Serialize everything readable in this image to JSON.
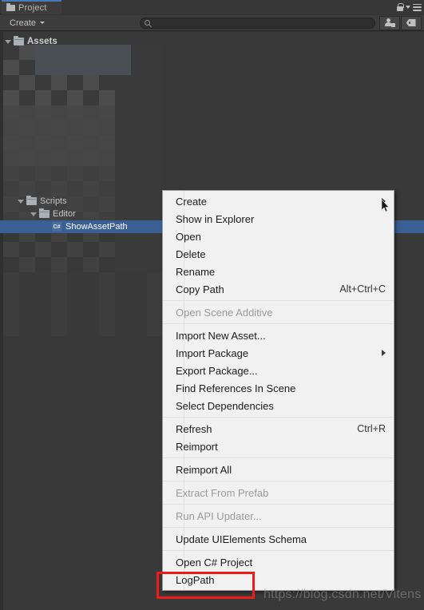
{
  "window": {
    "tab_label": "Project",
    "tab_icon": "folder-icon",
    "lock_icon": "lock-icon",
    "menu_icon": "hamburger-menu-icon",
    "dropdown_icon": "chevron-down-icon"
  },
  "toolbar": {
    "create_label": "Create",
    "create_caret": "chevron-down-icon",
    "search_placeholder": "",
    "search_value": "",
    "search_icon": "search-icon",
    "filter_by_type_icon": "filter-by-type-icon",
    "filter_by_label_icon": "filter-by-label-icon"
  },
  "tree": {
    "items": [
      {
        "label": "Assets",
        "indent": 0,
        "type": "folder",
        "expanded": true,
        "selected": false,
        "bold": true
      },
      {
        "label": "Scripts",
        "indent": 1,
        "type": "folder",
        "expanded": true,
        "selected": false,
        "bold": false
      },
      {
        "label": "Editor",
        "indent": 2,
        "type": "folder",
        "expanded": true,
        "selected": false,
        "bold": false
      },
      {
        "label": "ShowAssetPath",
        "indent": 3,
        "type": "csharp",
        "expanded": false,
        "selected": true,
        "bold": false
      }
    ],
    "csharp_badge": "C#"
  },
  "context_menu": {
    "items": [
      {
        "label": "Create",
        "shortcut": "",
        "submenu": true,
        "disabled": false,
        "sep_after": false
      },
      {
        "label": "Show in Explorer",
        "shortcut": "",
        "submenu": false,
        "disabled": false,
        "sep_after": false
      },
      {
        "label": "Open",
        "shortcut": "",
        "submenu": false,
        "disabled": false,
        "sep_after": false
      },
      {
        "label": "Delete",
        "shortcut": "",
        "submenu": false,
        "disabled": false,
        "sep_after": false
      },
      {
        "label": "Rename",
        "shortcut": "",
        "submenu": false,
        "disabled": false,
        "sep_after": false
      },
      {
        "label": "Copy Path",
        "shortcut": "Alt+Ctrl+C",
        "submenu": false,
        "disabled": false,
        "sep_after": true
      },
      {
        "label": "Open Scene Additive",
        "shortcut": "",
        "submenu": false,
        "disabled": true,
        "sep_after": true
      },
      {
        "label": "Import New Asset...",
        "shortcut": "",
        "submenu": false,
        "disabled": false,
        "sep_after": false
      },
      {
        "label": "Import Package",
        "shortcut": "",
        "submenu": true,
        "disabled": false,
        "sep_after": false
      },
      {
        "label": "Export Package...",
        "shortcut": "",
        "submenu": false,
        "disabled": false,
        "sep_after": false
      },
      {
        "label": "Find References In Scene",
        "shortcut": "",
        "submenu": false,
        "disabled": false,
        "sep_after": false
      },
      {
        "label": "Select Dependencies",
        "shortcut": "",
        "submenu": false,
        "disabled": false,
        "sep_after": true
      },
      {
        "label": "Refresh",
        "shortcut": "Ctrl+R",
        "submenu": false,
        "disabled": false,
        "sep_after": false
      },
      {
        "label": "Reimport",
        "shortcut": "",
        "submenu": false,
        "disabled": false,
        "sep_after": true
      },
      {
        "label": "Reimport All",
        "shortcut": "",
        "submenu": false,
        "disabled": false,
        "sep_after": true
      },
      {
        "label": "Extract From Prefab",
        "shortcut": "",
        "submenu": false,
        "disabled": true,
        "sep_after": true
      },
      {
        "label": "Run API Updater...",
        "shortcut": "",
        "submenu": false,
        "disabled": true,
        "sep_after": true
      },
      {
        "label": "Update UIElements Schema",
        "shortcut": "",
        "submenu": false,
        "disabled": false,
        "sep_after": true
      },
      {
        "label": "Open C# Project",
        "shortcut": "",
        "submenu": false,
        "disabled": false,
        "sep_after": false
      },
      {
        "label": "LogPath",
        "shortcut": "",
        "submenu": false,
        "disabled": false,
        "sep_after": false
      }
    ]
  },
  "annotation": {
    "highlight_target": "LogPath",
    "color": "#ee1c18"
  },
  "watermark": {
    "text": "https://blog.csdn.net/Vitens"
  },
  "colors": {
    "panel_bg": "#393939",
    "toolbar_bg": "#3c3c3c",
    "tab_accent": "#4a78b4",
    "selection_blue": "#3a5f95",
    "menu_bg": "#f1f1f1",
    "annotation_red": "#ee1c18"
  }
}
